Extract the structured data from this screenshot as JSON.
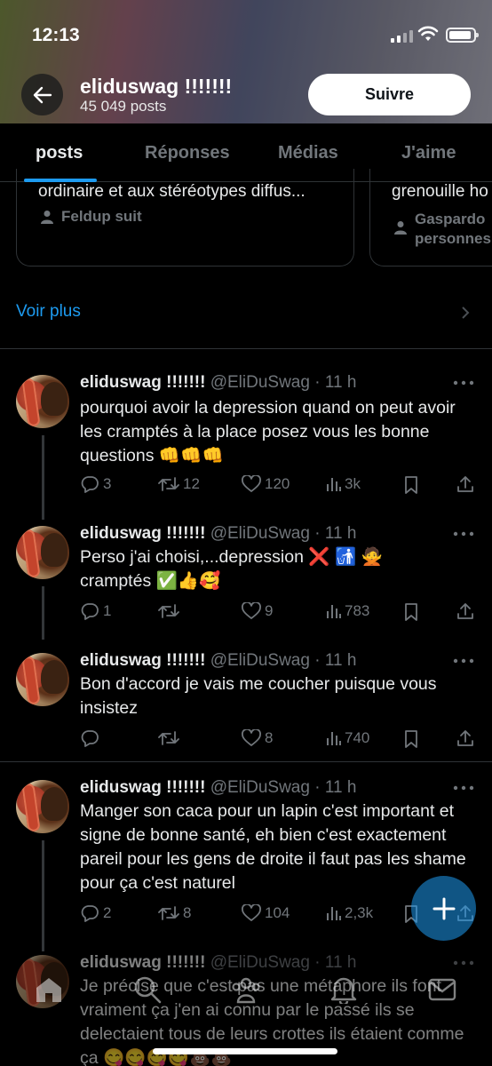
{
  "status_bar": {
    "time": "12:13"
  },
  "header": {
    "name": "eliduswag !!!!!!!",
    "post_count": "45 049 posts",
    "follow_label": "Suivre"
  },
  "tabs": [
    {
      "label": "posts",
      "active": true
    },
    {
      "label": "Réponses",
      "active": false
    },
    {
      "label": "Médias",
      "active": false
    },
    {
      "label": "J'aime",
      "active": false
    }
  ],
  "cards": [
    {
      "text": "ordinaire et aux stéréotypes diffus...",
      "sub": "Feldup suit"
    },
    {
      "text": "grenouille ho",
      "sub_line1": "Gaspardo",
      "sub_line2": "personnes"
    }
  ],
  "voir_plus": "Voir plus",
  "tweets": [
    {
      "name": "eliduswag !!!!!!!",
      "meta": "@EliDuSwag · 11 h",
      "body": "pourquoi avoir la depression quand on peut avoir les cramptés à la place posez vous les bonne questions 👊👊👊",
      "replies": "3",
      "retweets": "12",
      "likes": "120",
      "views": "3k"
    },
    {
      "name": "eliduswag !!!!!!!",
      "meta": "@EliDuSwag · 11 h",
      "body": "Perso j'ai choisi,...depression ❌ 🚮 🙅 cramptés ✅👍🥰",
      "replies": "1",
      "retweets": "",
      "likes": "9",
      "views": "783"
    },
    {
      "name": "eliduswag !!!!!!!",
      "meta": "@EliDuSwag · 11 h",
      "body": "Bon d'accord je vais me coucher puisque vous insistez",
      "replies": "",
      "retweets": "",
      "likes": "8",
      "views": "740"
    },
    {
      "name": "eliduswag !!!!!!!",
      "meta": "@EliDuSwag · 11 h",
      "body": "Manger son caca pour un lapin c'est important et signe de bonne santé, eh bien c'est exactement pareil pour les gens de droite il faut pas les shame pour ça c'est naturel",
      "replies": "2",
      "retweets": "8",
      "likes": "104",
      "views": "2,3k"
    },
    {
      "name": "eliduswag !!!!!!!",
      "meta": "@EliDuSwag · 11 h",
      "body": "Je précise que c'est pas une métaphore ils font vraiment ça j'en ai connu par le passé ils se delectaient tous de leurs crottes ils étaient comme ça 😋😋😋😋💩💩",
      "replies": "",
      "retweets": "",
      "likes": "",
      "views": ""
    }
  ],
  "colors": {
    "accent": "#1d9bf0",
    "muted": "#71767b",
    "text": "#e7e9ea",
    "bg": "#000000"
  },
  "icons": [
    "back-arrow-icon",
    "reply-icon",
    "retweet-icon",
    "heart-icon",
    "views-icon",
    "bookmark-icon",
    "share-icon",
    "more-icon",
    "compose-plus-icon",
    "home-icon",
    "search-icon",
    "communities-icon",
    "bell-icon",
    "mail-icon"
  ]
}
